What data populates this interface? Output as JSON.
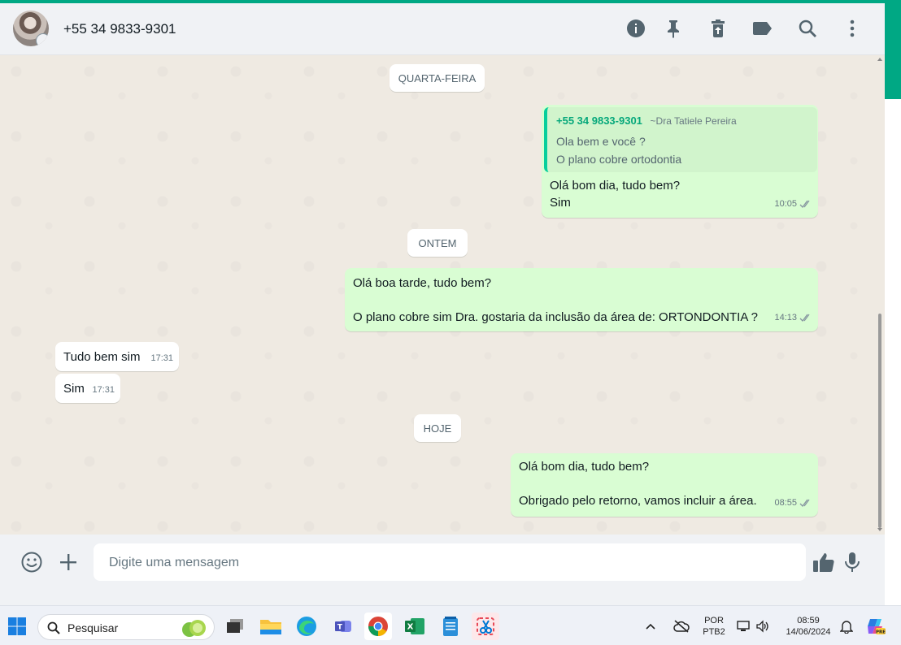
{
  "header": {
    "contact_name": "+55 34 9833-9301",
    "icons": [
      "info-icon",
      "pin-icon",
      "delete-icon",
      "label-icon",
      "search-icon",
      "menu-icon"
    ]
  },
  "chat": {
    "dates": {
      "wednesday": "QUARTA-FEIRA",
      "yesterday": "ONTEM",
      "today": "HOJE"
    },
    "m1": {
      "quote_author": "+55 34 9833-9301",
      "quote_name": "~Dra Tatiele Pereira",
      "quote_line1": "Ola bem e você ?",
      "quote_line2": "O plano cobre ortodontia",
      "line1": "Olá bom dia, tudo bem?",
      "line2": "Sim",
      "time": "10:05"
    },
    "m2": {
      "line1": "Olá boa tarde, tudo bem?",
      "line2": "O plano cobre sim Dra. gostaria da inclusão da área de:  ORTONDONTIA ?",
      "time": "14:13"
    },
    "m3": {
      "text": "Tudo bem sim",
      "time": "17:31"
    },
    "m4": {
      "text": "Sim",
      "time": "17:31"
    },
    "m5": {
      "line1": "Olá bom dia, tudo bem?",
      "line2": "Obrigado pelo retorno, vamos incluir a área.",
      "time": "08:55"
    }
  },
  "composer": {
    "placeholder": "Digite uma mensagem"
  },
  "taskbar": {
    "search_label": "Pesquisar",
    "lang1": "POR",
    "lang2": "PTB2",
    "clock_time": "08:59",
    "clock_date": "14/06/2024"
  },
  "colors": {
    "accent": "#00a884",
    "outgoing": "#d9fdd3",
    "incoming": "#ffffff",
    "chat_bg": "#efeae2"
  }
}
